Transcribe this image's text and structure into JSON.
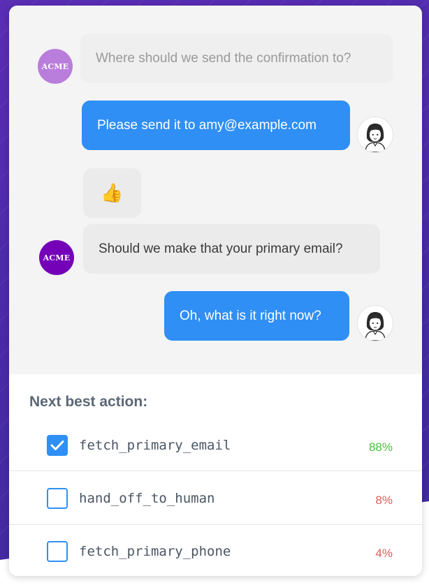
{
  "colors": {
    "user_bubble": "#2f8ff5",
    "bot_bubble": "#ebebeb",
    "acme_avatar_light": "#b97ddb",
    "acme_avatar_dark": "#7400b8",
    "pct_high": "#46c23a",
    "pct_low": "#e05b5b"
  },
  "chat": {
    "messages": [
      {
        "sender": "bot",
        "text": "Where should we send the confirmation to?",
        "avatar": "ACME"
      },
      {
        "sender": "user",
        "text": "Please send it to amy@example.com",
        "avatar_icon": "user-avatar-icon"
      },
      {
        "sender": "bot",
        "text": "👍"
      },
      {
        "sender": "bot",
        "text": "Should we make that your primary email?",
        "avatar": "ACME"
      },
      {
        "sender": "user",
        "text": "Oh, what is it right now?",
        "avatar_icon": "user-avatar-icon"
      }
    ]
  },
  "actions": {
    "title": "Next best action:",
    "items": [
      {
        "label": "fetch_primary_email",
        "percent": "88%",
        "checked": true,
        "icon": "check-icon"
      },
      {
        "label": "hand_off_to_human",
        "percent": "8%",
        "checked": false
      },
      {
        "label": "fetch_primary_phone",
        "percent": "4%",
        "checked": false
      }
    ]
  }
}
